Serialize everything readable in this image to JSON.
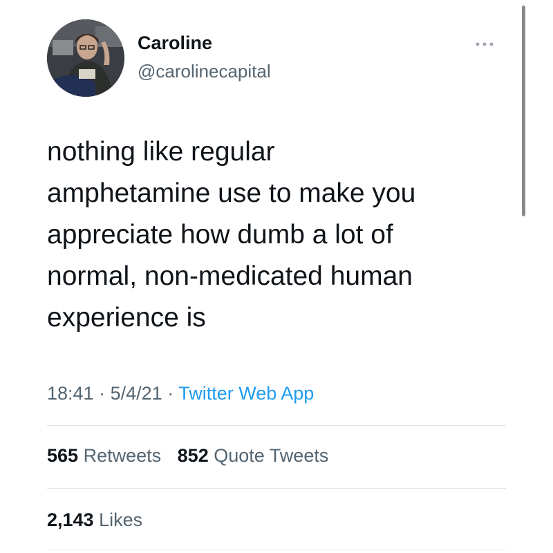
{
  "author": {
    "display_name": "Caroline",
    "handle": "@carolinecapital",
    "avatar_icon": "profile-photo"
  },
  "more_icon": "more-dots-icon",
  "tweet": {
    "text_lines": [
      "nothing like regular",
      "amphetamine use to make you",
      "appreciate how dumb a lot of",
      "normal, non-medicated human",
      "experience is"
    ],
    "time": "18:41",
    "date": "5/4/21",
    "separator": "·",
    "source": "Twitter Web App"
  },
  "stats": {
    "retweets_count": "565",
    "retweets_label": "Retweets",
    "quote_tweets_count": "852",
    "quote_tweets_label": "Quote Tweets",
    "likes_count": "2,143",
    "likes_label": "Likes"
  },
  "colors": {
    "text_primary": "#0f1419",
    "text_secondary": "#536471",
    "link": "#1d9bf0",
    "divider": "#e1e6ea"
  }
}
